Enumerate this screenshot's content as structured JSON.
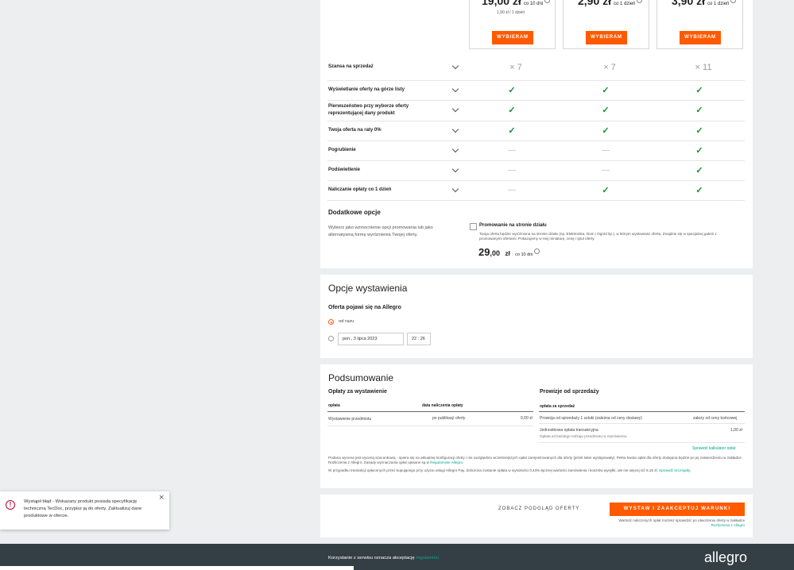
{
  "pricing": {
    "plans": [
      {
        "price_int": "19",
        "price_dec": ",00 zł",
        "per": "co 10 dni",
        "sub": "1,90 zł / 1 dzień",
        "button": "WYBIERAM"
      },
      {
        "price_int": "2",
        "price_dec": ",90 zł",
        "per": "co 1 dzień",
        "sub": "",
        "button": "WYBIERAM"
      },
      {
        "price_int": "3",
        "price_dec": ",90 zł",
        "per": "co 1 dzień",
        "sub": "",
        "button": "WYBIERAM"
      }
    ]
  },
  "features": [
    {
      "label": "Szansa na sprzedaż",
      "values": [
        "× 7",
        "× 7",
        "× 11"
      ],
      "kind": [
        "times",
        "times",
        "times"
      ]
    },
    {
      "label": "Wyświetlanie oferty na górze listy",
      "kind": [
        "check",
        "check",
        "check"
      ]
    },
    {
      "label": "Pierwszeństwo przy wyborze oferty reprezentującej dany produkt",
      "kind": [
        "check",
        "check",
        "check"
      ]
    },
    {
      "label": "Twoja oferta na raty 0%",
      "kind": [
        "check",
        "check",
        "check"
      ]
    },
    {
      "label": "Pogrubienie",
      "kind": [
        "dash",
        "dash",
        "check"
      ]
    },
    {
      "label": "Podświetlenie",
      "kind": [
        "dash",
        "dash",
        "check"
      ]
    },
    {
      "label": "Naliczanie opłaty co 1 dzień",
      "kind": [
        "dash",
        "check",
        "check"
      ]
    }
  ],
  "extras": {
    "title": "Dodatkowe opcje",
    "desc": "Wybierz jako wzmocnienie opcji promowania lub jako alternatywną formę wyróżnienia Twojej oferty.",
    "option_label": "Promowanie na stronie działu",
    "option_desc": "Twoja oferta będzie wyróżniona na stronie działu (np. Elektronika, Dom i Ogród itp.), w którym wystawiasz ofertę. Znajdzie się w specjalnej galerii z promowanymi ofertami. Pokazujemy w niej miniaturę, cenę i tytuł oferty.",
    "price_int": "29",
    "price_dec": ",00",
    "currency": "zł",
    "per": "co 10 dni"
  },
  "listing": {
    "title": "Opcje wystawienia",
    "subtitle": "Oferta pojawi się na Allegro",
    "opt_now": "od razu",
    "date_value": "pon., 3 lipca 2023",
    "time_value": "22 : 26"
  },
  "summary": {
    "title": "Podsumowanie",
    "fees_title": "Opłaty za wystawienie",
    "col_fee": "opłata",
    "col_date": "data naliczenia opłaty",
    "fee_row_label": "Wystawienie przedmiotu",
    "fee_row_date": "po publikacji oferty",
    "fee_row_amount": "0,00 zł",
    "comm_title": "Prowizje od sprzedaży",
    "comm_col": "opłata za sprzedaż",
    "comm_row1_label": "Prowizja od sprzedaży 1 sztuki (zależna od ceny dostawy)",
    "comm_row1_value": "zależy od ceny końcowej",
    "comm_row2_label": "Jednostkowa opłata transakcyjna",
    "comm_row2_sub": "Opłata od każdego rodzaju przedmiotu w zamówieniu.",
    "comm_row2_value": "1,00 zł",
    "calc_link": "Sprawdź kalkulator opłat",
    "note1": "Podana wycena jest wyceną szacunkową - opiera się na aktualnej konfiguracji oferty i nie uwzględnia wcześniejszych opłat zarejestrowanych dla oferty (jeżeli takie występowały). Pełna kwota opłat dla oferty dostępna będzie po jej zatwierdzeniu w zakładce Rozliczenia z Allegro. Zasady wyznaczania opłat opisane są w",
    "note1_link": "Regulaminie Allegro.",
    "note2": "W przypadku transakcji opłaconych przez kupującego przy użyciu usługi Allegro Pay, doliczona zostanie opłata w wysokości 0,43% łącznej wartości zamówienia i kosztów wysyłki, ale nie więcej niż 6,15 zł.",
    "note2_link": "Sprawdź szczegóły."
  },
  "actions": {
    "preview": "ZOBACZ PODGLĄD OFERTY",
    "submit": "WYSTAW I ZAAKCEPTUJ WARUNKI",
    "note": "Wartość naliczonych opłat możesz sprawdzić po utworzeniu oferty w zakładce",
    "note_link": "Rozliczenia z Allegro"
  },
  "toast": {
    "message": "Wystąpił błąd - Wskazany produkt posiada specyfikację techniczną TecDoc, przypisz ją do oferty. Zaktualizuj dane produktowe w ofercie."
  },
  "footer": {
    "text": "Korzystanie z serwisu oznacza akceptację",
    "link": "regulaminu",
    "logo": "allegro"
  },
  "colors": {
    "accent": "#ff5a00",
    "check": "#1a8c2e",
    "link": "#00a790",
    "footer": "#343f45"
  }
}
